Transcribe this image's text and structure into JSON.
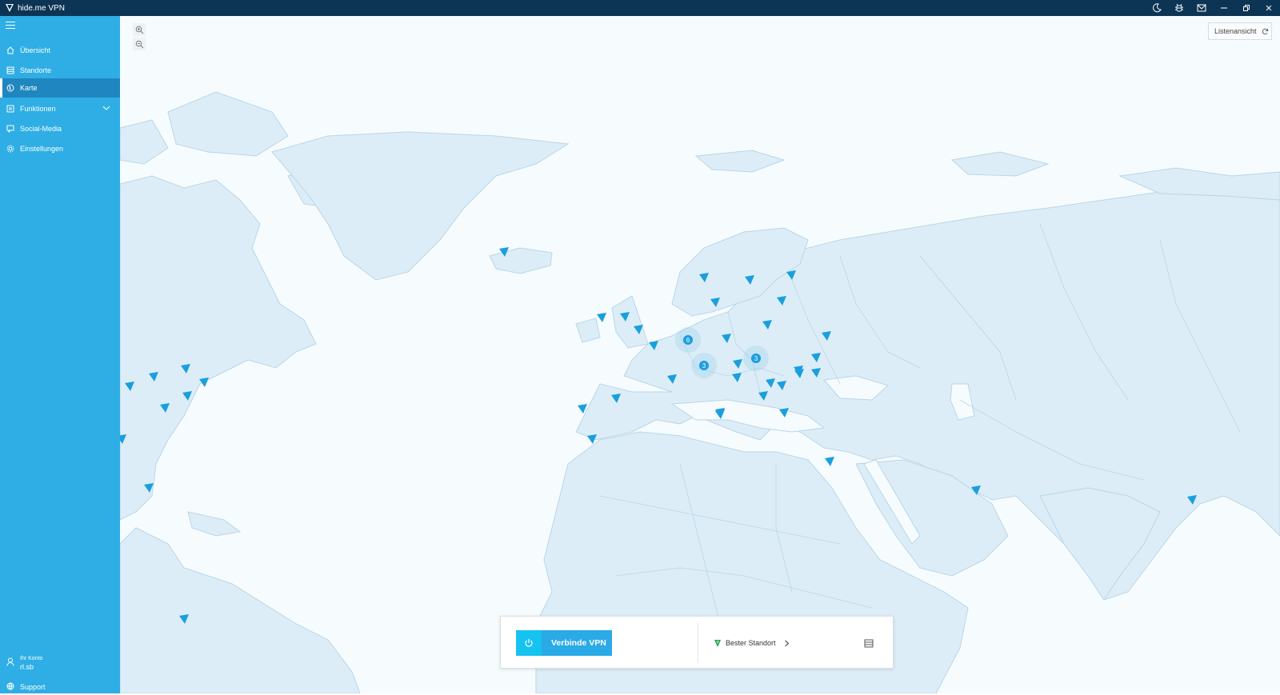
{
  "titlebar": {
    "title": "hide.me VPN",
    "icons": [
      "moon-icon",
      "bug-icon",
      "mail-icon",
      "minimize-icon",
      "restore-icon",
      "close-icon"
    ]
  },
  "sidebar": {
    "items": [
      {
        "label": "Übersicht",
        "icon": "home-icon"
      },
      {
        "label": "Standorte",
        "icon": "list-icon"
      },
      {
        "label": "Karte",
        "icon": "globe-icon",
        "active": true
      },
      {
        "label": "Funktionen",
        "icon": "features-icon"
      },
      {
        "label": "Social-Media",
        "icon": "chat-icon"
      },
      {
        "label": "Einstellungen",
        "icon": "gear-icon"
      }
    ],
    "account_label": "Ihr Konto",
    "username": "rl.sb",
    "support_label": "Support"
  },
  "map": {
    "list_view_label": "Listenansicht",
    "cluster_counts": [
      "6",
      "3",
      "3"
    ]
  },
  "connect_panel": {
    "connect_label": "Verbinde VPN",
    "best_location_label": "Bester Standort"
  },
  "colors": {
    "titlebar": "#0c3454",
    "sidebar": "#2eaee4",
    "sidebar_active": "#1f86bf",
    "land": "#dcedf7",
    "land_border": "#b9d6e8",
    "ocean": "#f6fbfd",
    "marker": "#1a9fdd",
    "connect_button": "#2aaae6"
  }
}
